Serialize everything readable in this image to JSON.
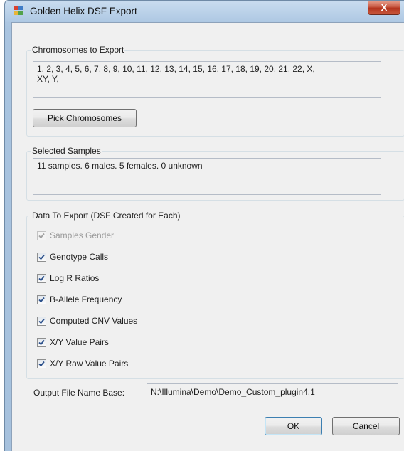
{
  "window": {
    "title": "Golden Helix DSF Export",
    "close_label": "X",
    "app_icon": "window-app-icon"
  },
  "chromosomes": {
    "group_label": "Chromosomes to Export",
    "list_line1": "1, 2, 3, 4, 5, 6, 7, 8, 9, 10, 11, 12, 13, 14, 15, 16, 17, 18, 19, 20, 21, 22, X,",
    "list_line2": "XY, Y,",
    "pick_button": "Pick Chromosomes"
  },
  "samples": {
    "group_label": "Selected Samples",
    "summary": "11 samples. 6 males. 5 females. 0 unknown"
  },
  "data_export": {
    "group_label": "Data To Export (DSF Created for Each)",
    "options": [
      {
        "label": "Samples Gender",
        "checked": true,
        "enabled": false
      },
      {
        "label": "Genotype Calls",
        "checked": true,
        "enabled": true
      },
      {
        "label": "Log R Ratios",
        "checked": true,
        "enabled": true
      },
      {
        "label": "B-Allele Frequency",
        "checked": true,
        "enabled": true
      },
      {
        "label": "Computed CNV Values",
        "checked": true,
        "enabled": true
      },
      {
        "label": "X/Y Value Pairs",
        "checked": true,
        "enabled": true
      },
      {
        "label": "X/Y Raw Value Pairs",
        "checked": true,
        "enabled": true
      }
    ]
  },
  "output": {
    "label": "Output File Name Base:",
    "value": "N:\\Illumina\\Demo\\Demo_Custom_plugin4.1"
  },
  "buttons": {
    "ok": "OK",
    "cancel": "Cancel"
  },
  "colors": {
    "check_enabled": "#2a4f8a",
    "check_disabled": "#a0a0a0",
    "close_button": "#c34a34"
  }
}
